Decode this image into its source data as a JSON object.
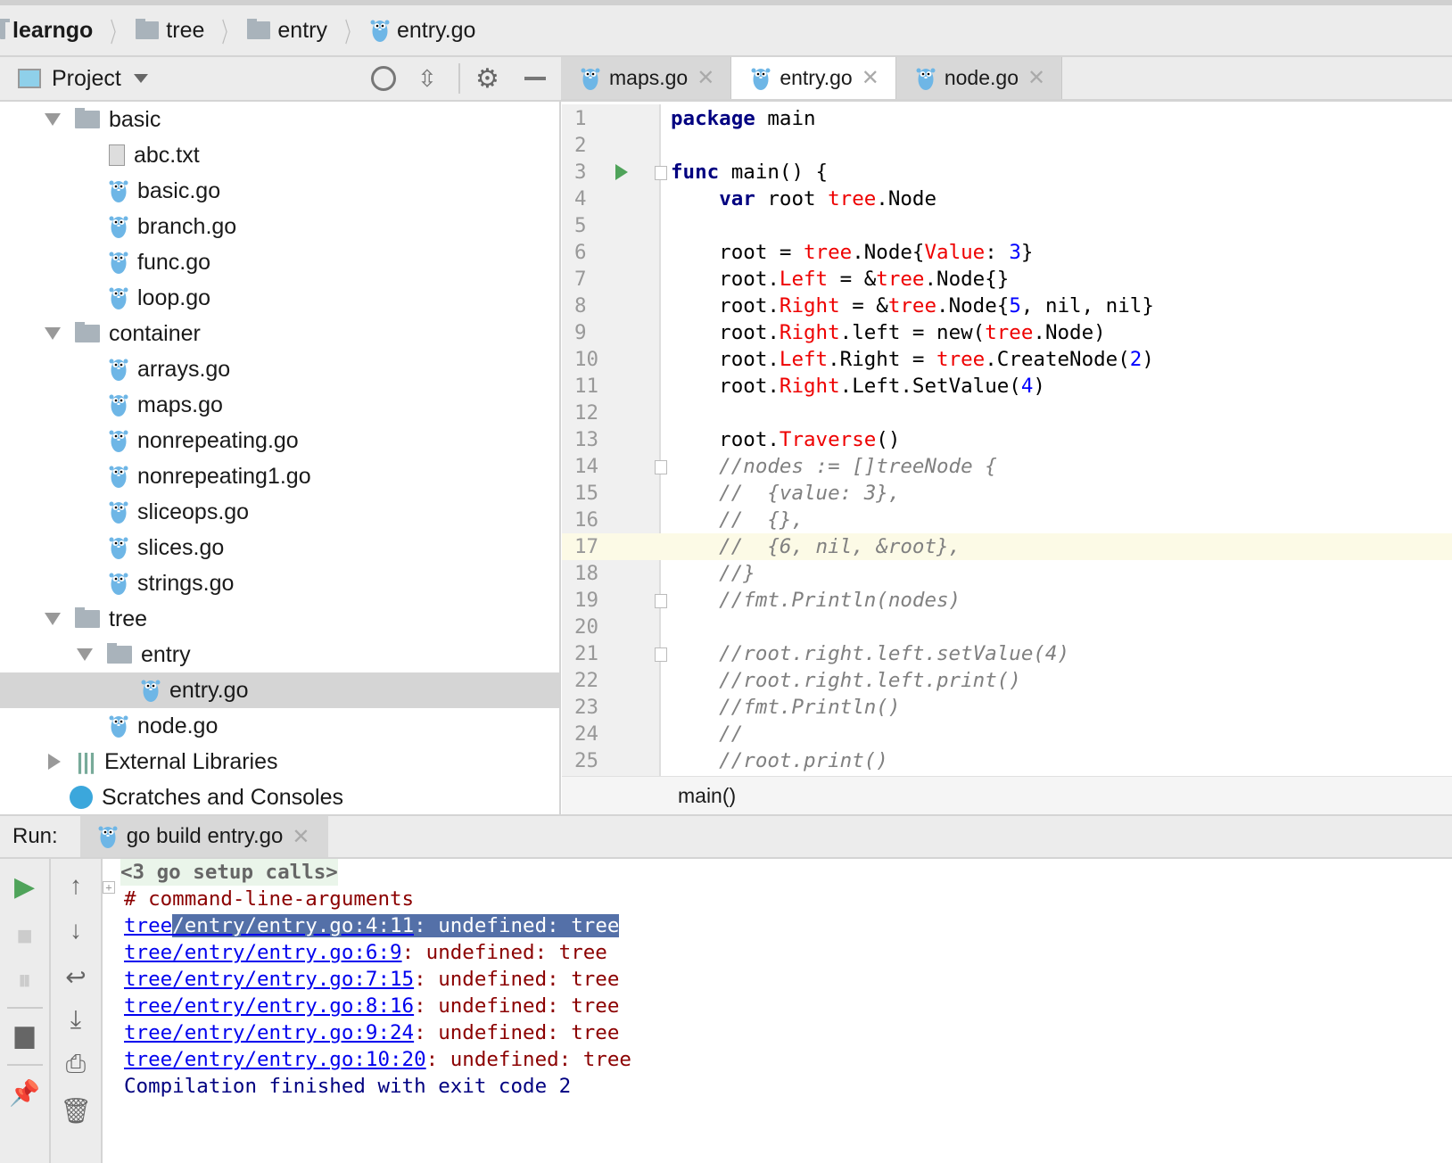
{
  "breadcrumb": [
    "learngo",
    "tree",
    "entry",
    "entry.go"
  ],
  "project_panel": {
    "title": "Project"
  },
  "tree": [
    {
      "label": "basic",
      "type": "folder",
      "depth": 0,
      "open": true
    },
    {
      "label": "abc.txt",
      "type": "text",
      "depth": 1
    },
    {
      "label": "basic.go",
      "type": "go",
      "depth": 1
    },
    {
      "label": "branch.go",
      "type": "go",
      "depth": 1
    },
    {
      "label": "func.go",
      "type": "go",
      "depth": 1
    },
    {
      "label": "loop.go",
      "type": "go",
      "depth": 1
    },
    {
      "label": "container",
      "type": "folder",
      "depth": 0,
      "open": true
    },
    {
      "label": "arrays.go",
      "type": "go",
      "depth": 1
    },
    {
      "label": "maps.go",
      "type": "go",
      "depth": 1
    },
    {
      "label": "nonrepeating.go",
      "type": "go",
      "depth": 1
    },
    {
      "label": "nonrepeating1.go",
      "type": "go",
      "depth": 1
    },
    {
      "label": "sliceops.go",
      "type": "go",
      "depth": 1
    },
    {
      "label": "slices.go",
      "type": "go",
      "depth": 1
    },
    {
      "label": "strings.go",
      "type": "go",
      "depth": 1
    },
    {
      "label": "tree",
      "type": "folder",
      "depth": 0,
      "open": true
    },
    {
      "label": "entry",
      "type": "folder",
      "depth": 1,
      "open": true
    },
    {
      "label": "entry.go",
      "type": "go",
      "depth": 2,
      "selected": true
    },
    {
      "label": "node.go",
      "type": "go",
      "depth": 1
    },
    {
      "label": "External Libraries",
      "type": "lib",
      "depth": -1,
      "open": false
    },
    {
      "label": "Scratches and Consoles",
      "type": "scratch",
      "depth": -1
    }
  ],
  "tabs": [
    {
      "label": "maps.go"
    },
    {
      "label": "entry.go",
      "active": true
    },
    {
      "label": "node.go"
    }
  ],
  "code": [
    [
      [
        "package",
        "kw"
      ],
      [
        " main",
        "id"
      ]
    ],
    [],
    [
      [
        "func",
        "kw"
      ],
      [
        " main() {",
        "id"
      ]
    ],
    [
      [
        "    ",
        "id"
      ],
      [
        "var",
        "kw"
      ],
      [
        " root ",
        "id"
      ],
      [
        "tree",
        "pkg"
      ],
      [
        ".Node",
        "id"
      ]
    ],
    [],
    [
      [
        "    root = ",
        "id"
      ],
      [
        "tree",
        "pkg"
      ],
      [
        ".Node{",
        "id"
      ],
      [
        "Value",
        "pkg"
      ],
      [
        ": ",
        "id"
      ],
      [
        "3",
        "num"
      ],
      [
        "}",
        "id"
      ]
    ],
    [
      [
        "    root.",
        "id"
      ],
      [
        "Left",
        "pkg"
      ],
      [
        " = &",
        "id"
      ],
      [
        "tree",
        "pkg"
      ],
      [
        ".Node{}",
        "id"
      ]
    ],
    [
      [
        "    root.",
        "id"
      ],
      [
        "Right",
        "pkg"
      ],
      [
        " = &",
        "id"
      ],
      [
        "tree",
        "pkg"
      ],
      [
        ".Node{",
        "id"
      ],
      [
        "5",
        "num"
      ],
      [
        ", nil, nil}",
        "id"
      ]
    ],
    [
      [
        "    root.",
        "id"
      ],
      [
        "Right",
        "pkg"
      ],
      [
        ".left = new(",
        "id"
      ],
      [
        "tree",
        "pkg"
      ],
      [
        ".Node)",
        "id"
      ]
    ],
    [
      [
        "    root.",
        "id"
      ],
      [
        "Left",
        "pkg"
      ],
      [
        ".Right = ",
        "id"
      ],
      [
        "tree",
        "pkg"
      ],
      [
        ".CreateNode(",
        "id"
      ],
      [
        "2",
        "num"
      ],
      [
        ")",
        "id"
      ]
    ],
    [
      [
        "    root.",
        "id"
      ],
      [
        "Right",
        "pkg"
      ],
      [
        ".Left.SetValue(",
        "id"
      ],
      [
        "4",
        "num"
      ],
      [
        ")",
        "id"
      ]
    ],
    [],
    [
      [
        "    root.",
        "id"
      ],
      [
        "Traverse",
        "pkg"
      ],
      [
        "()",
        "id"
      ]
    ],
    [
      [
        "    //nodes := []treeNode {",
        "cm"
      ]
    ],
    [
      [
        "    //  {value: 3},",
        "cm"
      ]
    ],
    [
      [
        "    //  {},",
        "cm"
      ]
    ],
    [
      [
        "    //  {6, nil, &root},",
        "cm"
      ]
    ],
    [
      [
        "    //}",
        "cm"
      ]
    ],
    [
      [
        "    //fmt.Println(nodes)",
        "cm"
      ]
    ],
    [],
    [
      [
        "    //root.right.left.setValue(4)",
        "cm"
      ]
    ],
    [
      [
        "    //root.right.left.print()",
        "cm"
      ]
    ],
    [
      [
        "    //fmt.Println()",
        "cm"
      ]
    ],
    [
      [
        "    //",
        "cm"
      ]
    ],
    [
      [
        "    //root.print()",
        "cm"
      ]
    ]
  ],
  "highlighted_line": 17,
  "run_gutter_line": 3,
  "fold_lines": [
    3,
    14,
    19,
    21
  ],
  "editor_breadcrumb": "main()",
  "run": {
    "label": "Run:",
    "tab": "go build entry.go"
  },
  "console": {
    "setup": "<3 go setup calls>",
    "header": "# command-line-arguments",
    "errors": [
      {
        "link": "tree/entry/entry.go:4:11",
        "msg": ": undefined: tree"
      },
      {
        "link": "tree/entry/entry.go:6:9",
        "msg": ": undefined: tree"
      },
      {
        "link": "tree/entry/entry.go:7:15",
        "msg": ": undefined: tree"
      },
      {
        "link": "tree/entry/entry.go:8:16",
        "msg": ": undefined: tree"
      },
      {
        "link": "tree/entry/entry.go:9:24",
        "msg": ": undefined: tree"
      },
      {
        "link": "tree/entry/entry.go:10:20",
        "msg": ": undefined: tree"
      }
    ],
    "footer": "Compilation finished with exit code 2"
  },
  "colors": {
    "keyword": "#000080",
    "package": "#ee0000",
    "number": "#0000ff",
    "comment": "#808080",
    "link": "#0000ee",
    "error": "#8b0000",
    "selection": "#5470a8",
    "current_line": "#fcfae6"
  }
}
